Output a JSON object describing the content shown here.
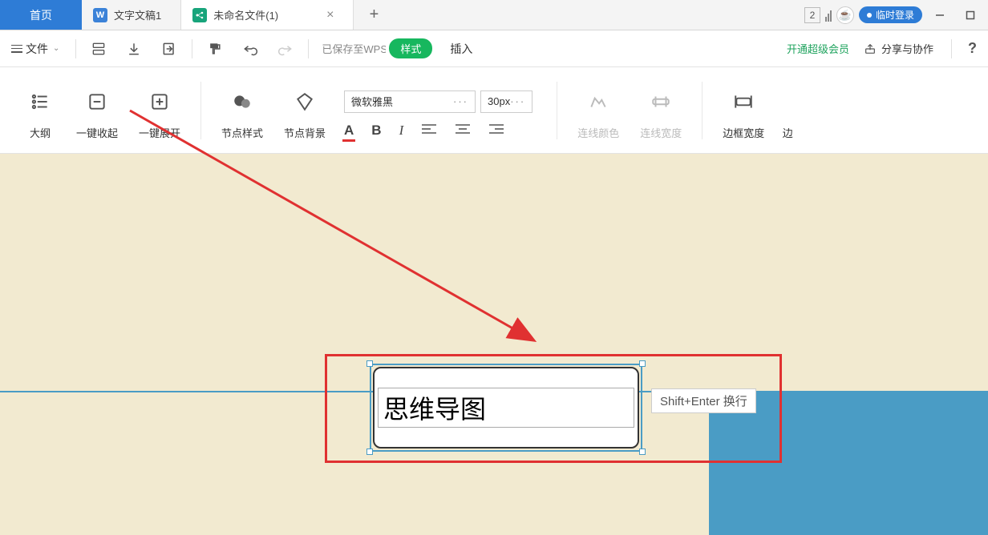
{
  "titlebar": {
    "home": "首页",
    "tab1": "文字文稿1",
    "tab2": "未命名文件(1)",
    "badge": "2",
    "login_pill": "临时登录"
  },
  "menubar": {
    "file": "文件",
    "saved": "已保存至WPS",
    "style": "样式",
    "insert": "插入",
    "premium": "开通超级会员",
    "share": "分享与协作",
    "help": "?"
  },
  "toolbar": {
    "outline": "大纲",
    "collapse": "一键收起",
    "expand": "一键展开",
    "node_style": "节点样式",
    "node_bg": "节点背景",
    "font_name": "微软雅黑",
    "font_size": "30px",
    "line_color": "连线颜色",
    "line_width": "连线宽度",
    "border_width": "边框宽度",
    "border_cut": "边"
  },
  "canvas": {
    "node_text": "思维导图",
    "tooltip": "Shift+Enter 换行"
  }
}
